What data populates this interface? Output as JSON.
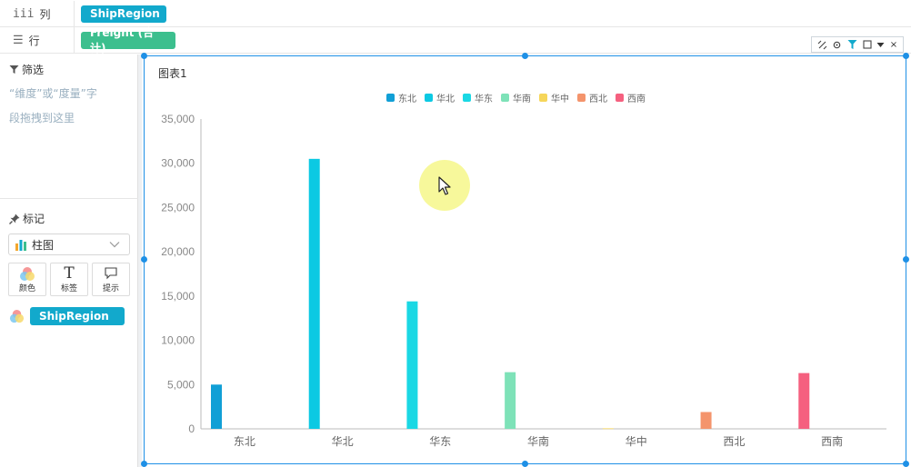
{
  "shelves": {
    "columns": {
      "label": "列",
      "field": "ShipRegion"
    },
    "rows": {
      "label": "行",
      "field": "Freight (合计)"
    }
  },
  "filter": {
    "title": "筛选",
    "hint_line1": "“维度”或“度量”字",
    "hint_line2": "段拖拽到这里"
  },
  "marks": {
    "title": "标记",
    "chart_type": "柱图",
    "buttons": {
      "color": "颜色",
      "label": "标签",
      "tooltip": "提示"
    },
    "color_field": "ShipRegion"
  },
  "chart": {
    "title": "图表1",
    "toolbar_close": "×"
  },
  "colors": {
    "dimension_pill": "#12a9cc",
    "measure_pill": "#3cbf8e",
    "selection": "#1e90e6"
  },
  "chart_data": {
    "type": "bar",
    "categories": [
      "东北",
      "华北",
      "华东",
      "华南",
      "华中",
      "西北",
      "西南"
    ],
    "values": [
      5000,
      30500,
      14400,
      6400,
      60,
      1900,
      6300
    ],
    "series_colors": [
      "#119fd6",
      "#0cc9e3",
      "#1ad8e4",
      "#7ee2b8",
      "#f6d65a",
      "#f4946c",
      "#f5607f"
    ],
    "legend": [
      "东北",
      "华北",
      "华东",
      "华南",
      "华中",
      "西北",
      "西南"
    ],
    "legend_position": "top-center",
    "yticks": [
      "0",
      "5,000",
      "10,000",
      "15,000",
      "20,000",
      "25,000",
      "30,000",
      "35,000"
    ],
    "ylim": [
      0,
      35000
    ],
    "grid": false
  }
}
